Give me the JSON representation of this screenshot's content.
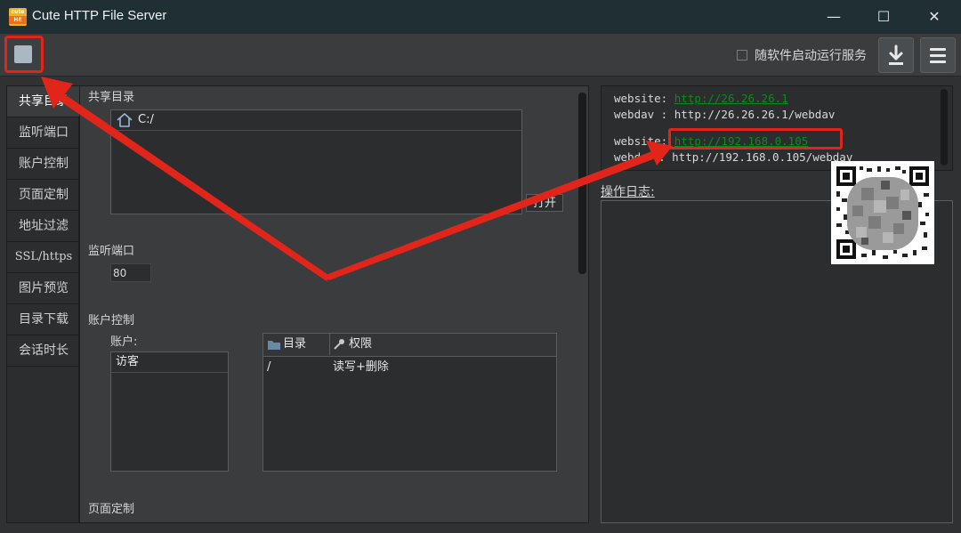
{
  "titlebar": {
    "title": "Cute HTTP File Server",
    "logo_top": "cute",
    "logo_bottom": "HE",
    "minimize": "—",
    "maximize": "☐",
    "close": "✕"
  },
  "toolbar": {
    "autostart_label": "随软件启动运行服务",
    "download_icon": "download-icon",
    "menu_icon": "menu-icon",
    "stop_icon": "stop-icon"
  },
  "sidebar": {
    "items": [
      {
        "label": "共享目录",
        "active": true
      },
      {
        "label": "监听端口"
      },
      {
        "label": "账户控制"
      },
      {
        "label": "页面定制"
      },
      {
        "label": "地址过滤"
      },
      {
        "label": "SSL/https"
      },
      {
        "label": "图片预览"
      },
      {
        "label": "目录下载"
      },
      {
        "label": "会话时长"
      }
    ]
  },
  "shared_dir": {
    "title": "共享目录",
    "items": [
      "C:/"
    ],
    "open_label": "打开"
  },
  "listen_port": {
    "title": "监听端口",
    "value": "80"
  },
  "accounts": {
    "title": "账户控制",
    "account_label": "账户:",
    "users": [
      "访客"
    ],
    "columns": [
      "目录",
      "权限"
    ],
    "rows": [
      {
        "dir": "/",
        "perm": "读写+删除"
      }
    ]
  },
  "page_custom": {
    "title": "页面定制"
  },
  "urls": {
    "website1_key": "website:",
    "website1_url": "http://26.26.26.1",
    "webdav1_key": "webdav :",
    "webdav1_url": "http://26.26.26.1/webdav",
    "website2_key": "website:",
    "website2_url": "http://192.168.0.105",
    "webdav2_key": "webd",
    "webdav2_url": ": http://192.168.0.105/webdav"
  },
  "log": {
    "label": "操作日志:"
  },
  "colors": {
    "accent_red": "#e1251b",
    "link_green": "#0d8a1e"
  }
}
